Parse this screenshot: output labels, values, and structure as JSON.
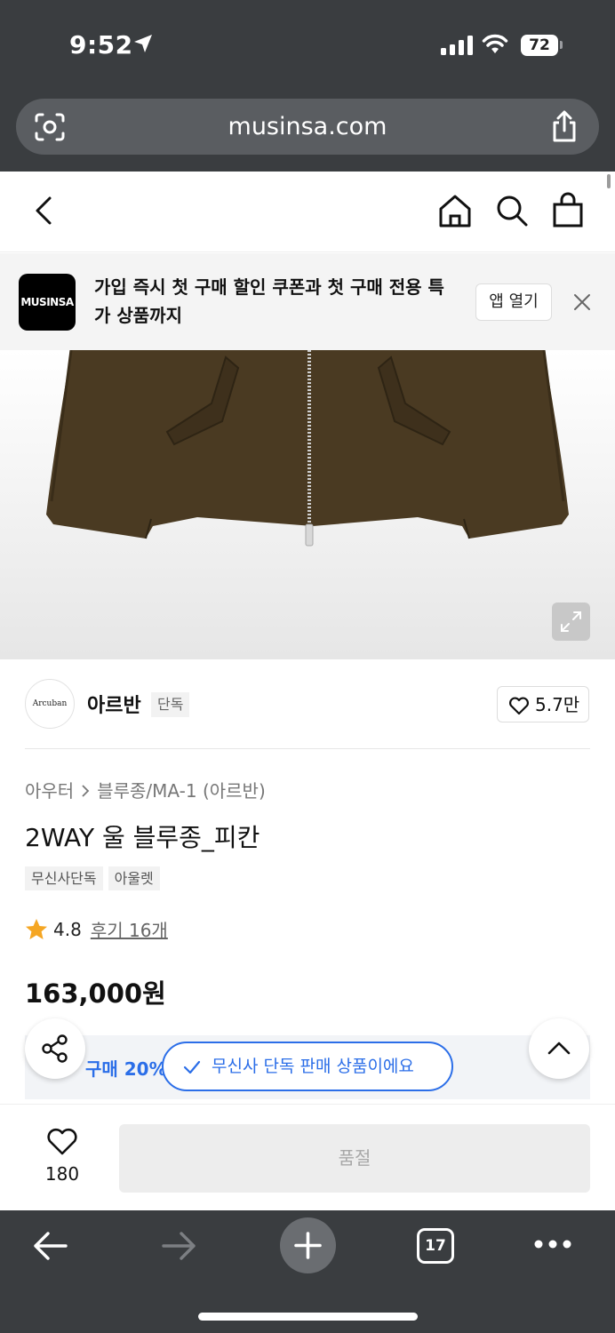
{
  "status_bar": {
    "time": "9:52",
    "battery": "72"
  },
  "browser": {
    "url": "musinsa.com",
    "tab_count": "17"
  },
  "app_banner": {
    "logo_text": "MUSINSA",
    "message": "가입 즉시 첫 구매 할인 쿠폰과 첫 구매 전용 특가 상품까지",
    "open_label": "앱 열기"
  },
  "brand": {
    "logo_text": "Arcuban",
    "name": "아르반",
    "badge": "단독",
    "like_count": "5.7만"
  },
  "product": {
    "breadcrumb": [
      "아우터",
      "블루종/MA-1 (아르반)"
    ],
    "title": "2WAY 울 블루종_피칸",
    "tags": [
      "무신사단독",
      "아울렛"
    ],
    "rating": "4.8",
    "reviews": "후기 16개",
    "price": "163,000원",
    "coupon_text": "구매 20% 쿠폰"
  },
  "toast": {
    "text": "무신사 단독 판매 상품이에요"
  },
  "buy_bar": {
    "wish_count": "180",
    "soldout_label": "품절"
  },
  "colors": {
    "accent": "#2b6ee8",
    "star": "#f5a623",
    "jacket": "#4a3a22",
    "chrome": "#3a3d40"
  },
  "icons": [
    "location-arrow-icon",
    "signal-icon",
    "wifi-icon",
    "screenshot-icon",
    "share-icon",
    "back-icon",
    "home-icon",
    "search-icon",
    "bag-icon",
    "close-icon",
    "expand-icon",
    "heart-icon",
    "star-icon",
    "chevron-right-icon",
    "chevron-up-icon",
    "check-icon",
    "plus-icon",
    "more-icon"
  ]
}
